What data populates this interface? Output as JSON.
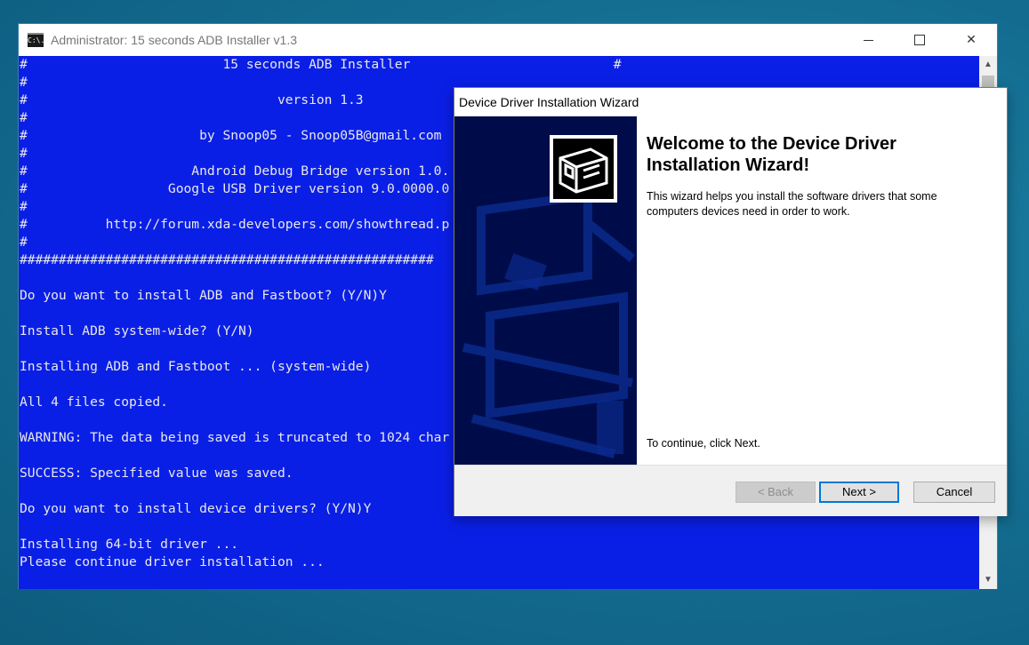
{
  "console": {
    "title": "Administrator:  15 seconds ADB Installer v1.3",
    "icon": "C:\\.",
    "controls": {
      "minimize": "minimize-icon",
      "maximize": "maximize-icon",
      "close": "✕"
    },
    "lines": [
      "#                         15 seconds ADB Installer                          #",
      "#",
      "#                                version 1.3",
      "#",
      "#                      by Snoop05 - Snoop05B@gmail.com",
      "#",
      "#                     Android Debug Bridge version 1.0.",
      "#                  Google USB Driver version 9.0.0000.0",
      "#",
      "#          http://forum.xda-developers.com/showthread.p",
      "#",
      "#####################################################",
      "",
      "Do you want to install ADB and Fastboot? (Y/N)Y",
      "",
      "Install ADB system-wide? (Y/N)",
      "",
      "Installing ADB and Fastboot ... (system-wide)",
      "",
      "All 4 files copied.",
      "",
      "WARNING: The data being saved is truncated to 1024 char",
      "",
      "SUCCESS: Specified value was saved.",
      "",
      "Do you want to install device drivers? (Y/N)Y",
      "",
      "Installing 64-bit driver ...",
      "Please continue driver installation ..."
    ]
  },
  "wizard": {
    "title": "Device Driver Installation Wizard",
    "heading": "Welcome to the Device Driver Installation Wizard!",
    "description": "This wizard helps you install the software drivers that some computers devices need in order to work.",
    "continue_text": "To continue, click Next.",
    "buttons": {
      "back": "< Back",
      "next": "Next >",
      "cancel": "Cancel"
    }
  },
  "colors": {
    "console_bg": "#0a1fe6",
    "wizard_sidebar": "#000c4a",
    "accent": "#0078d7"
  }
}
